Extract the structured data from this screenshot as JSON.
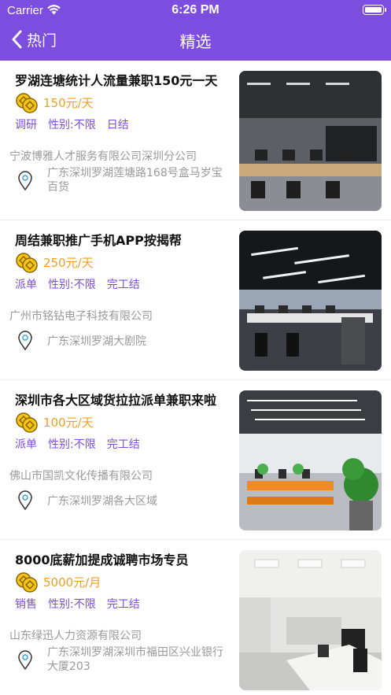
{
  "status_bar": {
    "carrier": "Carrier",
    "time": "6:26 PM"
  },
  "nav": {
    "back_label": "热门",
    "title": "精选"
  },
  "colors": {
    "brand": "#7c4ddf",
    "salary": "#f0a020",
    "muted": "#999999"
  },
  "jobs": [
    {
      "title": "罗湖连塘统计人流量兼职150元一天",
      "salary": "150元/天",
      "tags": [
        "调研",
        "性别:不限",
        "日结"
      ],
      "company": "宁波博雅人才服务有限公司深圳分公司",
      "address": "广东深圳罗湖莲塘路168号盒马岁宝百货"
    },
    {
      "title": "周结兼职推广手机APP按揭帮",
      "salary": "250元/天",
      "tags": [
        "派单",
        "性别:不限",
        "完工结"
      ],
      "company": "广州市铭钻电子科技有限公司",
      "address": "广东深圳罗湖大剧院"
    },
    {
      "title": "深圳市各大区域货拉拉派单兼职来啦",
      "salary": "100元/天",
      "tags": [
        "派单",
        "性别:不限",
        "完工结"
      ],
      "company": "佛山市国凯文化传播有限公司",
      "address": "广东深圳罗湖各大区域"
    },
    {
      "title": "8000底薪加提成诚聘市场专员",
      "salary": "5000元/月",
      "tags": [
        "销售",
        "性别:不限",
        "完工结"
      ],
      "company": "山东绿迅人力资源有限公司",
      "address": "广东深圳罗湖深圳市福田区兴业银行大厦203"
    }
  ]
}
